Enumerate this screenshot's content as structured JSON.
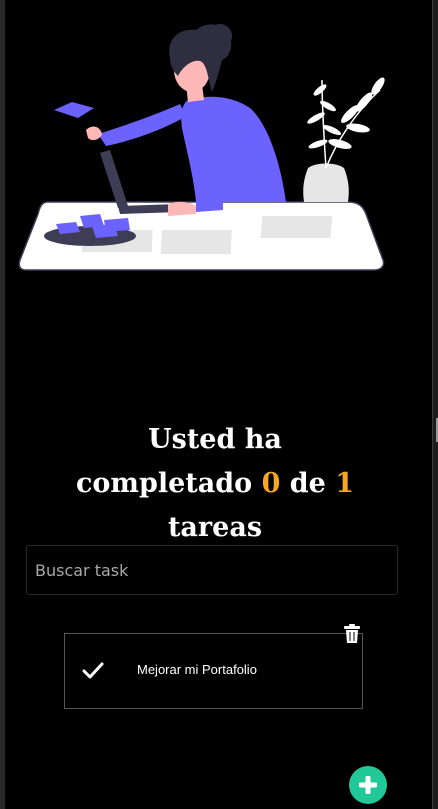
{
  "hero": {
    "illustration": "woman-at-desk-illustration"
  },
  "summary": {
    "line1": "Usted ha",
    "line2_prefix": "completado",
    "completed": "0",
    "connector": "de",
    "total": "1",
    "line3": "tareas"
  },
  "search": {
    "placeholder": "Buscar task",
    "value": ""
  },
  "tasks": [
    {
      "label": "Mejorar mi Portafolio",
      "completed": true
    }
  ],
  "icons": {
    "check": "check-icon",
    "delete": "trash-icon",
    "add": "plus-icon"
  },
  "colors": {
    "background": "#000000",
    "accent_number": "#f5a623",
    "add_button": "#20c997",
    "illustration_primary": "#6c63ff"
  }
}
